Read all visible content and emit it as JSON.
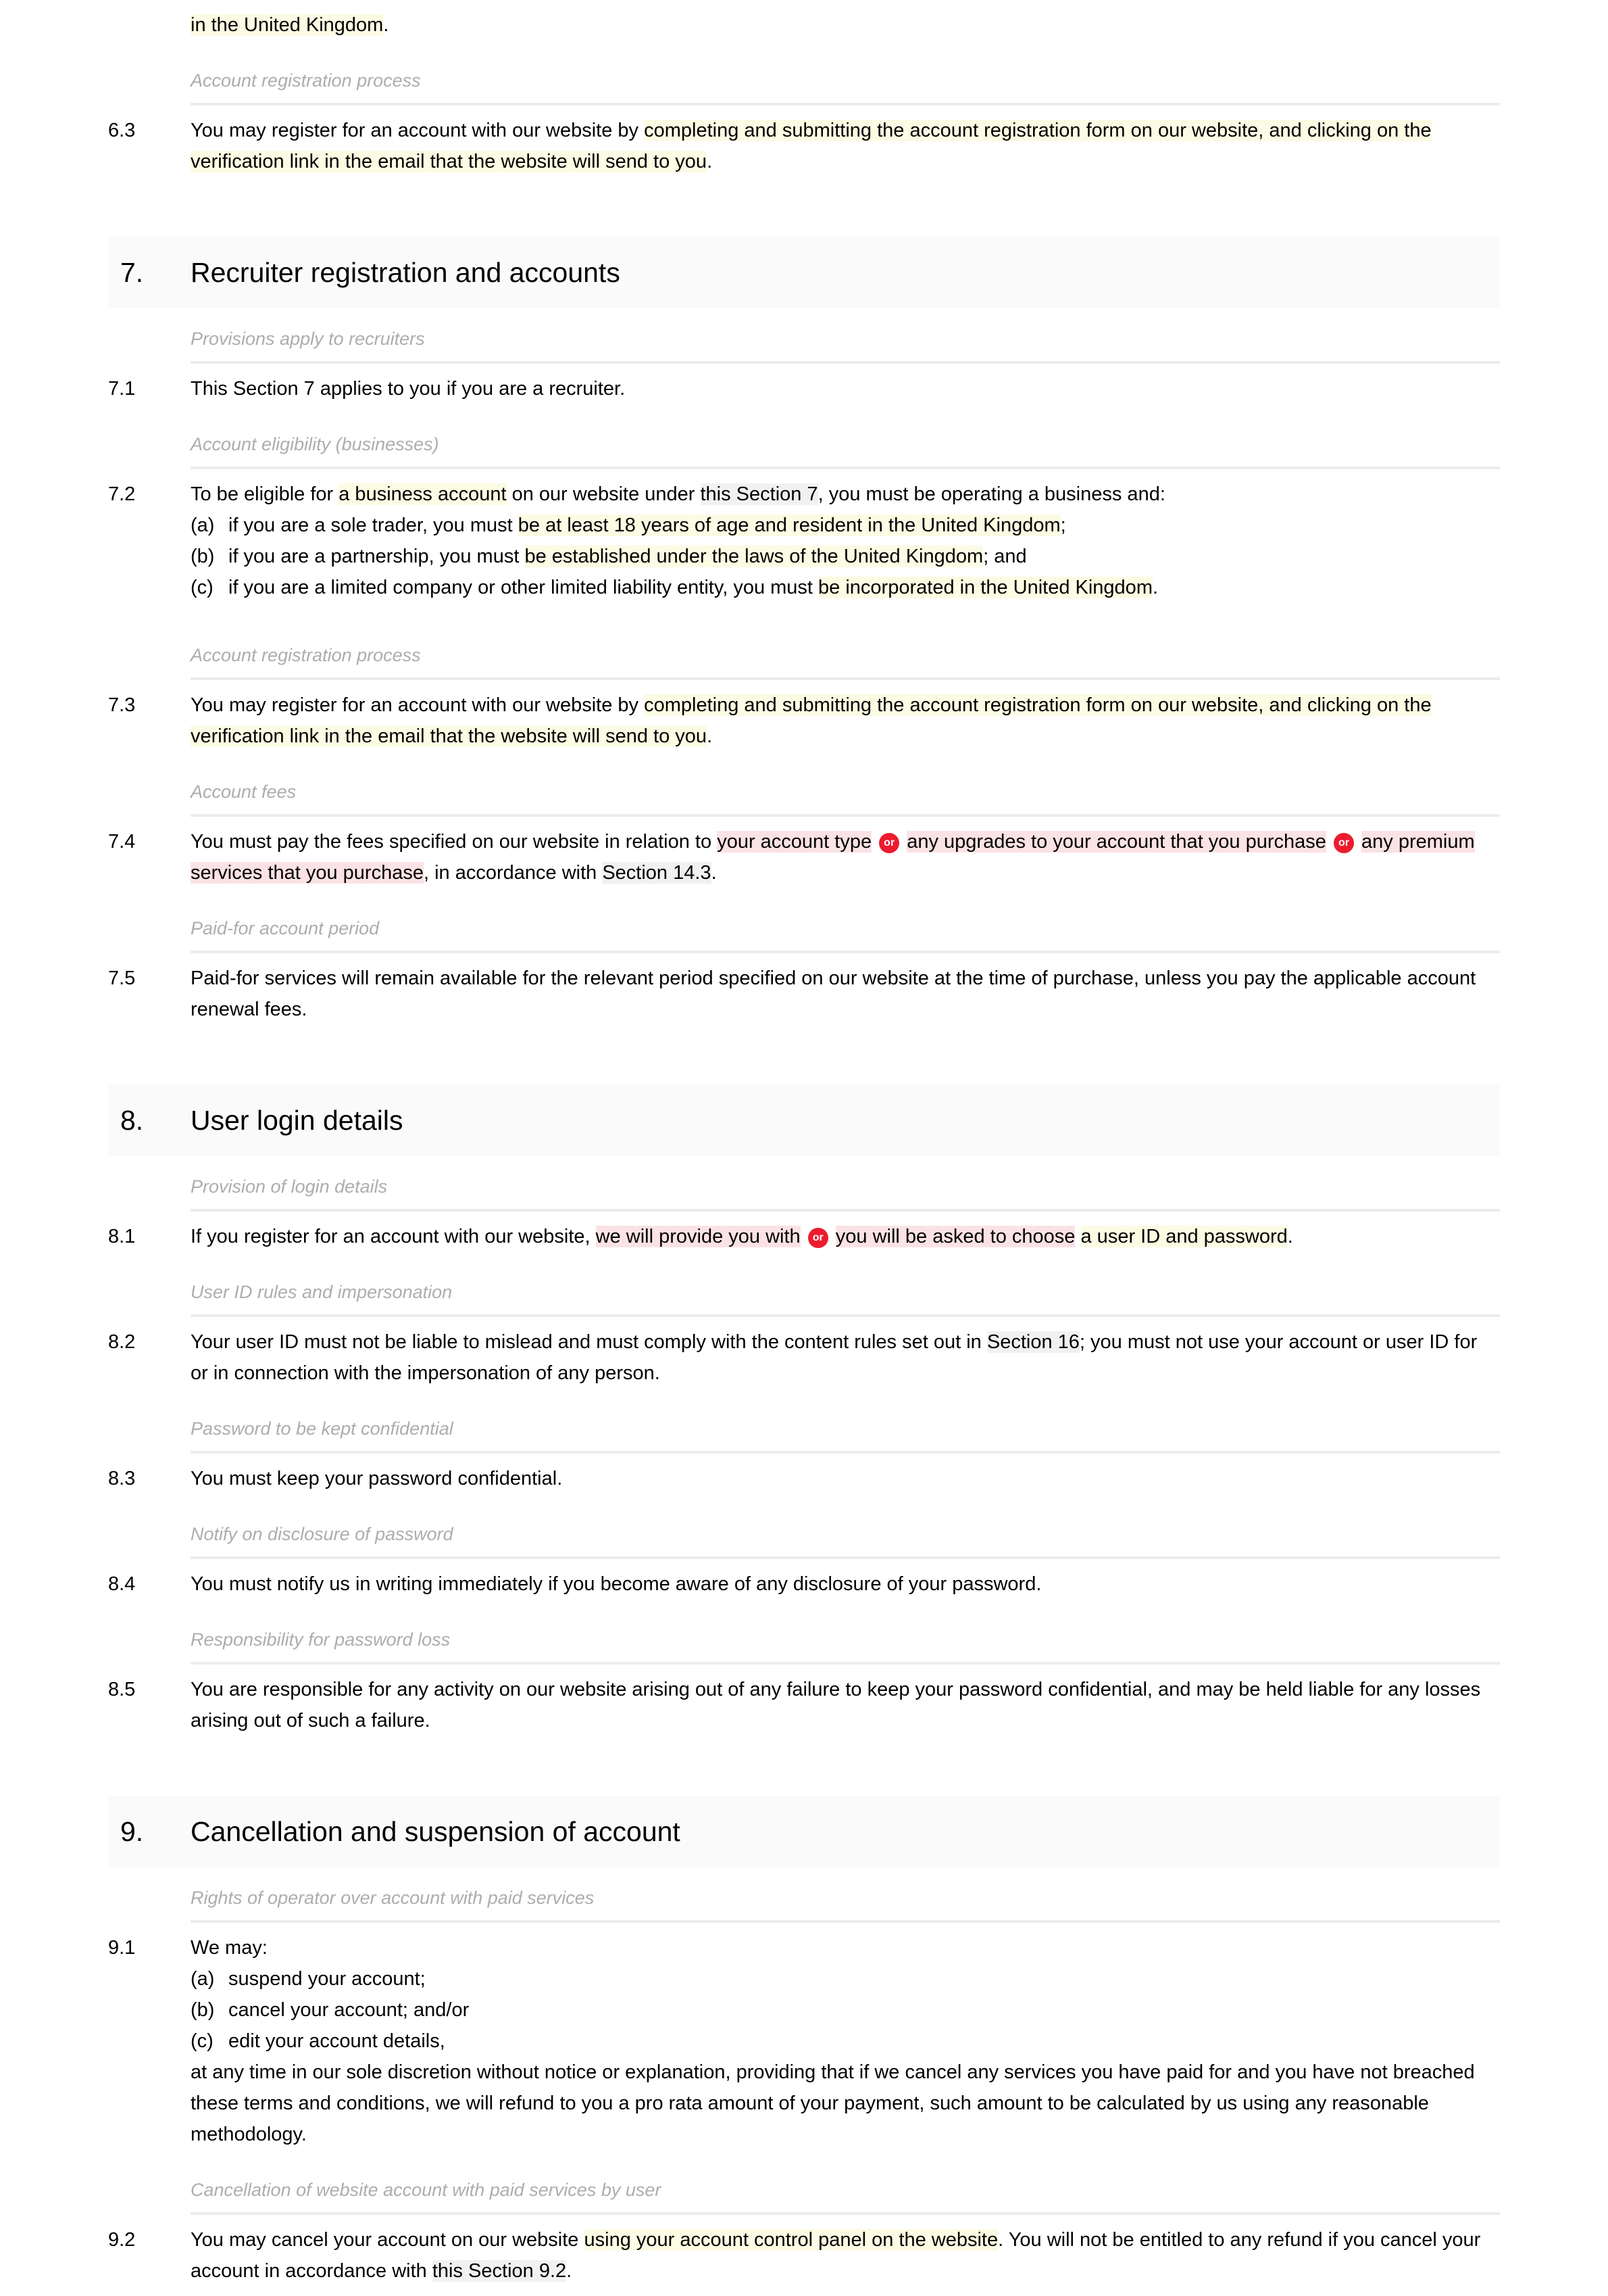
{
  "document": {
    "type": "terms-and-conditions",
    "colors": {
      "highlight_yellow": "#fcfbe3",
      "highlight_pink": "#fbe2e4",
      "highlight_gray": "#f1f1f1",
      "or_badge_background": "#ed1b2e",
      "or_badge_text": "#ffffff",
      "section_heading_background": "#fafafa",
      "note_label_text": "#adadad",
      "rule": "#ececec"
    },
    "or_badge_label": "or"
  },
  "continuation": {
    "clause_number": "",
    "text_before": "",
    "highlight": "in the United Kingdom",
    "text_after": "."
  },
  "blocks": {
    "c63": {
      "num": "6.3",
      "plain_start": "You may register for an account with our website by ",
      "highlight": "completing and submitting the account registration form on our website, and clicking on the verification link in the email that the website will send to you",
      "plain_end": "."
    },
    "note_account_registration_1": "Account registration process",
    "section7": {
      "num": "7.",
      "title": "Recruiter registration and accounts"
    },
    "note_provisions_recruiters": "Provisions apply to recruiters",
    "c71": {
      "num": "7.1",
      "text_a": "This Section 7 applies to you if you are a recruiter."
    },
    "note_account_eligibility": "Account eligibility (businesses)",
    "c72": {
      "num": "7.2",
      "lead_a": "To be eligible for ",
      "lead_hl": "a business account",
      "lead_b": " on our website under ",
      "lead_xref": "this Section 7",
      "lead_c": ", you must be operating a business and:",
      "items": [
        {
          "letter": "(a)",
          "plain": "if you are a sole trader, you must ",
          "highlight": "be at least 18 years of age and resident in the United Kingdom",
          "tail": ";"
        },
        {
          "letter": "(b)",
          "plain": "if you are a partnership, you must ",
          "highlight": "be established under the laws of the United Kingdom",
          "tail": "; and"
        },
        {
          "letter": "(c)",
          "plain": "if you are a limited company or other limited liability entity, you must ",
          "highlight": "be incorporated in the United Kingdom",
          "tail": "."
        }
      ]
    },
    "note_account_registration_2": "Account registration process",
    "c73": {
      "num": "7.3",
      "plain_start": "You may register for an account with our website by ",
      "highlight": "completing and submitting the account registration form on our website, and clicking on the verification link in the email that the website will send to you",
      "plain_end": "."
    },
    "note_account_fees": "Account fees",
    "c74": {
      "num": "7.4",
      "plain_start": "You must pay the fees specified on our website in relation to ",
      "alt1": "your account type",
      "alt2": "any upgrades to your account that you purchase",
      "alt3": "any premium services that you purchase",
      "plain_mid": ", in accordance with ",
      "xref": "Section 14.3",
      "plain_end": "."
    },
    "note_paid_for_period": "Paid-for account period",
    "c75": {
      "num": "7.5",
      "text_a": "Paid-for services will remain available for the relevant period specified on our website at the time of purchase, unless you pay the applicable account renewal fees."
    },
    "section8": {
      "num": "8.",
      "title": "User login details"
    },
    "note_provision_login": "Provision of login details",
    "c81": {
      "num": "8.1",
      "plain_start": "If you register for an account with our website, ",
      "alt1": "we will provide you with",
      "alt2": "you will be asked to choose",
      "highlight": "a user ID and password",
      "plain_end": "."
    },
    "note_userid_rules": "User ID rules and impersonation",
    "c82": {
      "num": "8.2",
      "plain_start": "Your user ID must not be liable to mislead and must comply with the content rules set out in ",
      "xref": "Section 16",
      "plain_end": "; you must not use your account or user ID for or in connection with the impersonation of any person."
    },
    "note_password_confidential": "Password to be kept confidential",
    "c83": {
      "num": "8.3",
      "text_a": "You must keep your password confidential."
    },
    "note_notify_disclosure": "Notify on disclosure of password",
    "c84": {
      "num": "8.4",
      "text_a": "You must notify us in writing immediately if you become aware of any disclosure of your password."
    },
    "note_responsibility_loss": "Responsibility for password loss",
    "c85": {
      "num": "8.5",
      "text_a": "You are responsible for any activity on our website arising out of any failure to keep your password confidential, and may be held liable for any losses arising out of such a failure."
    },
    "section9": {
      "num": "9.",
      "title": "Cancellation and suspension of account"
    },
    "note_rights_operator": "Rights of operator over account with paid services",
    "c91": {
      "num": "9.1",
      "lead": "We may:",
      "items": [
        {
          "letter": "(a)",
          "text": "suspend your account;"
        },
        {
          "letter": "(b)",
          "text": "cancel your account; and/or"
        },
        {
          "letter": "(c)",
          "text": "edit your account details,"
        }
      ],
      "tail": "at any time in our sole discretion without notice or explanation, providing that if we cancel any services you have paid for and you have not breached these terms and conditions, we will refund to you a pro rata amount of your payment, such amount to be calculated by us using any reasonable methodology."
    },
    "note_cancellation_by_user": "Cancellation of website account with paid services by user",
    "c92": {
      "num": "9.2",
      "plain_start": "You may cancel your account on our website ",
      "highlight": "using your account control panel on the website",
      "plain_mid": ". You will not be entitled to any refund if you cancel your account in accordance with ",
      "xref": "this Section 9.2",
      "plain_end": "."
    }
  }
}
